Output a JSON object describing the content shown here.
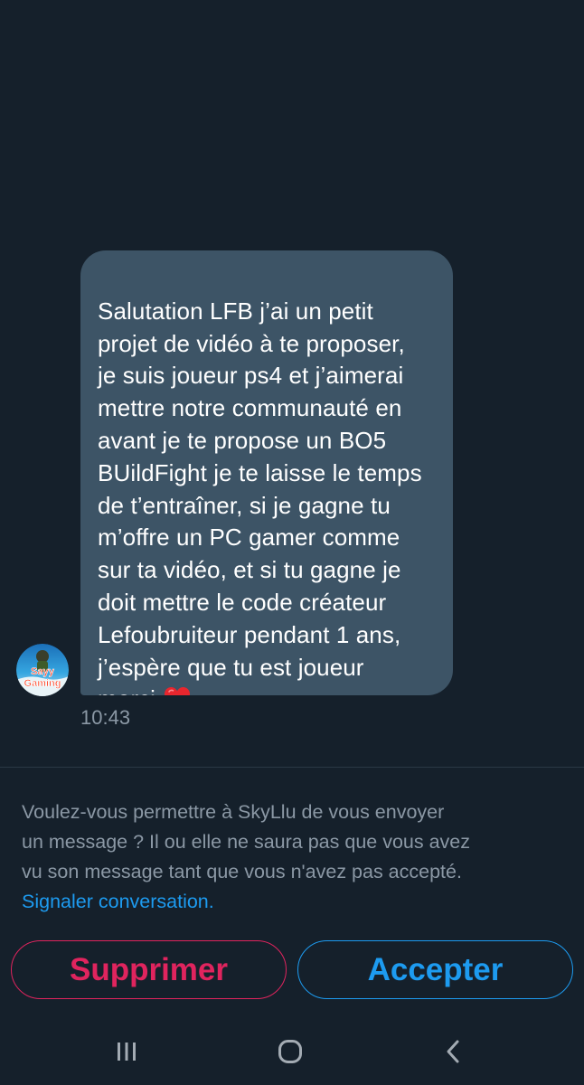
{
  "conversation": {
    "message_lines": [
      "Salutation LFB j’ai un petit",
      "projet de vidéo à te proposer,",
      "je suis joueur ps4 et j’aimerai",
      "mettre notre communauté en",
      "avant je te propose un BO5",
      "BUildFight je te laisse le temps",
      "de t’entraîner, si je gagne tu",
      "m’offre un PC gamer comme",
      "sur ta vidéo, et si tu gagne je",
      "doit mettre le code créateur",
      "Lefoubruiteur pendant 1 ans,",
      "j’espère que tu est joueur",
      "merci"
    ],
    "emoji": "heart-icon",
    "timestamp": "10:43",
    "avatar_icon": "avatar-icon",
    "avatar_text_top": "Sayy",
    "avatar_text_bottom": "Gaming"
  },
  "request": {
    "lines": [
      "Voulez-vous permettre à SkyLlu de vous envoyer",
      "un message ? Il ou elle ne saura pas que vous avez",
      "vu son message tant que vous n'avez pas accepté."
    ],
    "report_link": "Signaler conversation."
  },
  "buttons": {
    "delete_label": "Supprimer",
    "accept_label": "Accepter"
  },
  "navbar": {
    "icons": [
      "recent-apps-icon",
      "home-icon",
      "back-icon"
    ]
  },
  "colors": {
    "background": "#15202b",
    "bubble": "#3d5466",
    "muted_text": "#8b98a5",
    "accent_blue": "#1d9bf0",
    "danger_red": "#e0245e"
  }
}
